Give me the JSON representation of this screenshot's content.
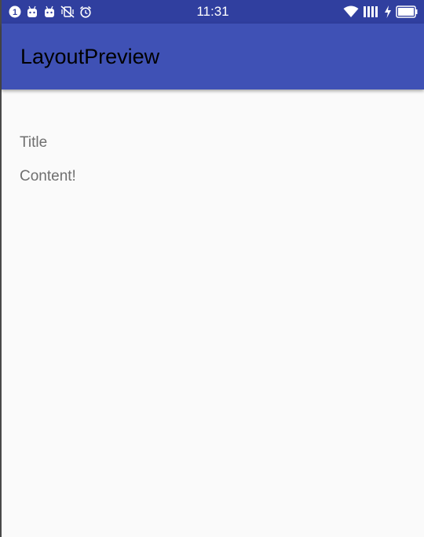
{
  "status_bar": {
    "time": "11:31",
    "color": "#303f9f",
    "left_icons": [
      "notification-count-icon",
      "android-icon",
      "android-icon",
      "vibrate-off-icon",
      "alarm-clock-icon"
    ],
    "notification_count": "1",
    "right_icons": [
      "wifi-icon",
      "signal-icon",
      "charging-icon",
      "battery-icon"
    ]
  },
  "app_bar": {
    "title": "LayoutPreview",
    "color": "#3f51b5"
  },
  "main": {
    "title_text": "Title",
    "content_text": "Content!"
  }
}
